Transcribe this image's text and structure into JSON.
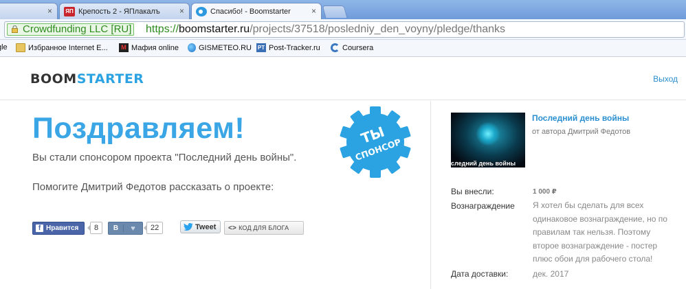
{
  "browser": {
    "tabs": [
      {
        "label": "",
        "active": false
      },
      {
        "label": "Крепость 2 - ЯПлакалъ",
        "active": false,
        "favicon_text": "ЯП"
      },
      {
        "label": "Спасибо! - Boomstarter",
        "active": true
      }
    ],
    "close_glyph": "×",
    "ev_badge": "Crowdfunding LLC [RU]",
    "url": {
      "scheme": "https://",
      "host": "boomstarter.ru",
      "path": "/projects/37518/posledniy_den_voyny/pledge/thanks"
    },
    "bookmarks": [
      {
        "label": "gle",
        "icon": "none"
      },
      {
        "label": "Избранное Internet E...",
        "icon": "folder-icon"
      },
      {
        "label": "Мафия online",
        "icon": "mafia-icon",
        "icon_text": "M"
      },
      {
        "label": "GISMETEO.RU",
        "icon": "gismeteo-icon"
      },
      {
        "label": "Post-Tracker.ru",
        "icon": "post-tracker-icon",
        "icon_text": "PT"
      },
      {
        "label": "Coursera",
        "icon": "coursera-icon"
      }
    ]
  },
  "header": {
    "logo_part1": "BOOM",
    "logo_part2": "STARTER",
    "logout": "Выход"
  },
  "main": {
    "title": "Поздравляем!",
    "sponsor_text": "Вы стали спонсором проекта \"Последний день войны\".",
    "help_text": "Помогите Дмитрий Федотов рассказать о проекте:",
    "badge_line1": "ТЫ",
    "badge_line2": "СПОНСОР",
    "social": {
      "fb_label": "Нравится",
      "fb_icon": "f",
      "fb_count": "8",
      "vk_label": "В",
      "vk_heart": "♥",
      "vk_count": "22",
      "tweet_label": "Tweet",
      "embed_icon": "<>",
      "embed_label": "КОД ДЛЯ БЛОГА"
    }
  },
  "sidebar": {
    "project_title": "Последний день войны",
    "project_author": "от автора Дмитрий Федотов",
    "thumb_caption": "следний день войны",
    "paid_label": "Вы внесли:",
    "paid_value": "1 000 ₽",
    "reward_label": "Вознаграждение",
    "reward_lines": [
      "Я хотел бы сделать для всех",
      "одинаковое вознаграждение, но по",
      "правилам так нельзя. Поэтому",
      "второе вознаграждение - постер",
      "плюс обои для рабочего стола!"
    ],
    "delivery_label": "Дата доставки:",
    "delivery_value": "дек. 2017"
  },
  "colors": {
    "brand_blue": "#3aa6e6",
    "link_blue": "#2a8fd0",
    "ev_green": "#2e8b1e"
  }
}
